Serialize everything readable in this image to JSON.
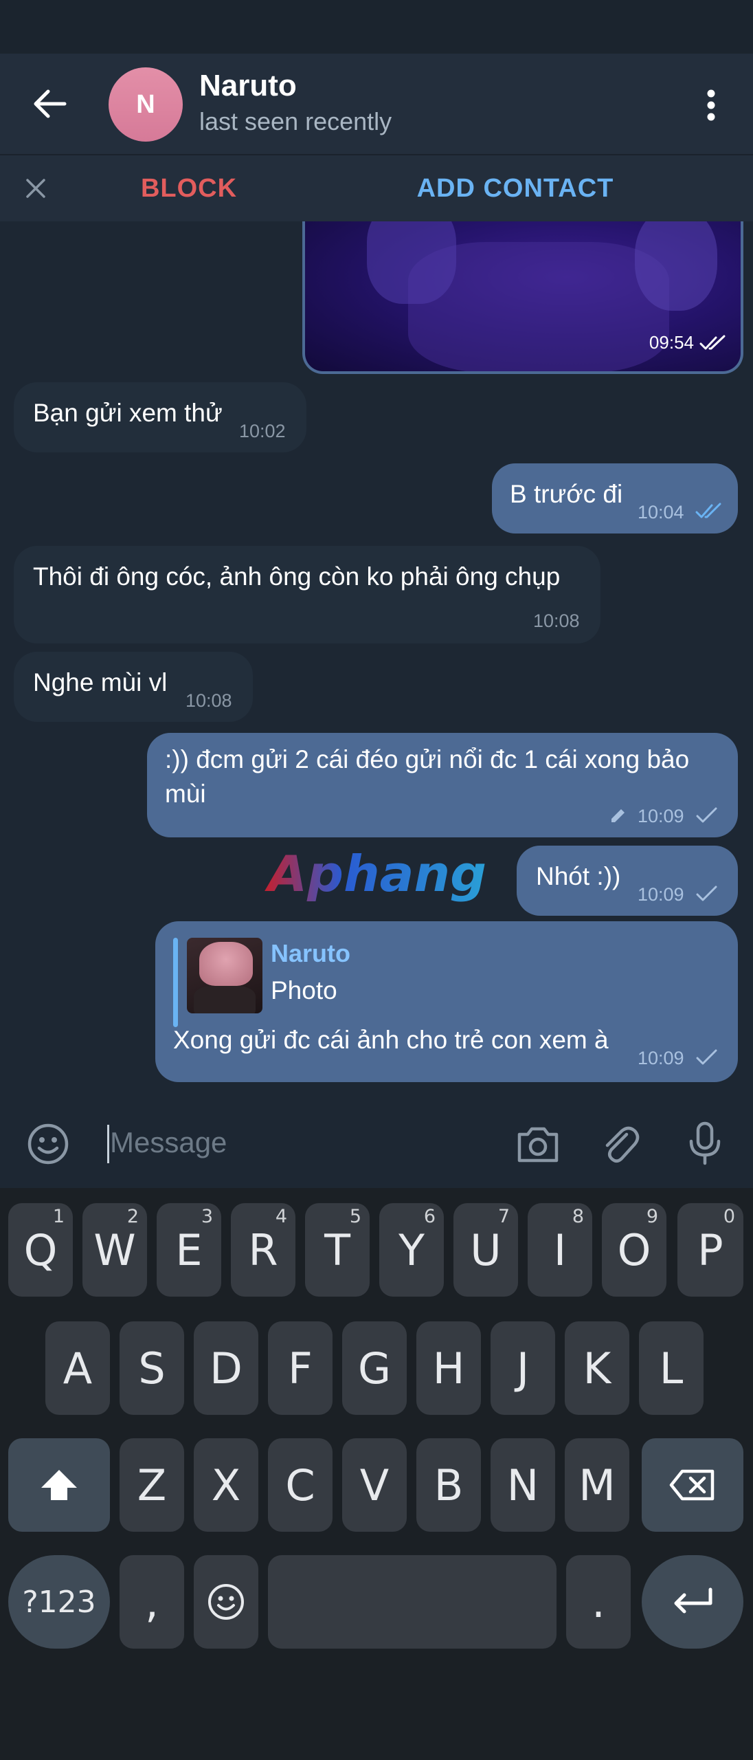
{
  "header": {
    "title": "Naruto",
    "status": "last seen recently",
    "avatar_letter": "N",
    "avatar_color": "#e28aa4"
  },
  "actionbar": {
    "block_label": "BLOCK",
    "add_contact_label": "ADD CONTACT",
    "block_color": "#e25d5d",
    "add_color": "#6ab3f3"
  },
  "messages": [
    {
      "type": "photo",
      "direction": "out",
      "time": "09:54",
      "status": "read"
    },
    {
      "direction": "in",
      "text": "Bạn gửi xem thử",
      "time": "10:02"
    },
    {
      "direction": "out",
      "text": "B trước đi",
      "time": "10:04",
      "status": "read"
    },
    {
      "direction": "in",
      "text": "Thôi đi ông cóc, ảnh ông còn ko phải ông chụp",
      "time": "10:08"
    },
    {
      "direction": "in",
      "text": "Nghe mùi vl",
      "time": "10:08"
    },
    {
      "direction": "out",
      "text_line1": ":)) đcm gửi 2 cái đéo gửi nổi đc 1 cái xong bảo",
      "text_line2": "mùi",
      "time": "10:09",
      "edited": true,
      "status": "sent"
    },
    {
      "direction": "out",
      "text": "Nhót :))",
      "time": "10:09",
      "status": "sent"
    },
    {
      "direction": "out",
      "reply_name": "Naruto",
      "reply_type": "Photo",
      "text": "Xong gửi đc cái ảnh cho trẻ con xem à",
      "time": "10:09",
      "status": "sent"
    }
  ],
  "watermark": "Aphang",
  "composer": {
    "placeholder": "Message"
  },
  "keyboard": {
    "row1": [
      {
        "label": "Q",
        "hint": "1"
      },
      {
        "label": "W",
        "hint": "2"
      },
      {
        "label": "E",
        "hint": "3"
      },
      {
        "label": "R",
        "hint": "4"
      },
      {
        "label": "T",
        "hint": "5"
      },
      {
        "label": "Y",
        "hint": "6"
      },
      {
        "label": "U",
        "hint": "7"
      },
      {
        "label": "I",
        "hint": "8"
      },
      {
        "label": "O",
        "hint": "9"
      },
      {
        "label": "P",
        "hint": "0"
      }
    ],
    "row2": [
      "A",
      "S",
      "D",
      "F",
      "G",
      "H",
      "J",
      "K",
      "L"
    ],
    "row3": [
      "Z",
      "X",
      "C",
      "V",
      "B",
      "N",
      "M"
    ],
    "symbols_label": "?123",
    "comma_label": ",",
    "period_label": "."
  }
}
